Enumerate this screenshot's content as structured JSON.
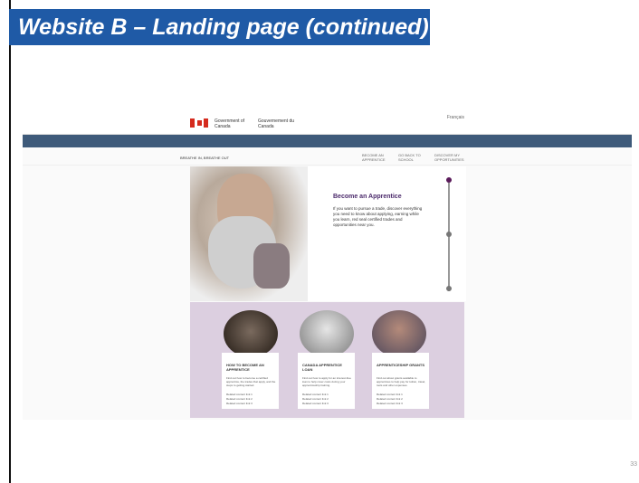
{
  "slide": {
    "title": "Website B – Landing page (continued)",
    "page_number": "33"
  },
  "site": {
    "gov_en": "Government of Canada",
    "gov_fr": "Gouvernement du Canada",
    "language_link": "Français",
    "breadcrumb": "BREATHE IN, BREATHE OUT",
    "menu": [
      "BECOME AN APPRENTICE",
      "GO BACK TO SCHOOL",
      "DISCOVER MY OPPORTUNITIES"
    ],
    "hero": {
      "title": "Become an Apprentice",
      "text": "If you want to pursue a trade, discover everything you need to know about applying, earning while you learn, red seal certified trades and opportunities near you."
    },
    "cards": [
      {
        "title": "HOW TO BECOME AN APPRENTICE",
        "body": "Find out how to become a certified apprentice, the trades that apply, and the steps to getting started.",
        "links": [
          "Related content link 1",
          "Related content link 2",
          "Related content link 3"
        ]
      },
      {
        "title": "CANADA APPRENTICE LOAN",
        "body": "Find out how to apply for an interest-free loan to help cover costs during your apprenticeship training.",
        "links": [
          "Related content link 1",
          "Related content link 2",
          "Related content link 3"
        ]
      },
      {
        "title": "APPRENTICESHIP GRANTS",
        "body": "Find out about grants available to apprentices to help pay for tuition, travel, tools and other expenses.",
        "links": [
          "Related content link 1",
          "Related content link 2",
          "Related content link 3"
        ]
      }
    ]
  },
  "colors": {
    "banner": "#1f5aa6",
    "nav": "#3e5a7a",
    "accent": "#4b2a6b",
    "cards_bg": "#dccfe0",
    "flag_red": "#d52b1e"
  }
}
